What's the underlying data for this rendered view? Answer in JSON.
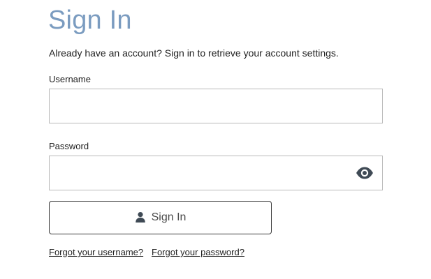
{
  "page": {
    "title": "Sign In",
    "intro": "Already have an account? Sign in to retrieve your account settings."
  },
  "form": {
    "username": {
      "label": "Username",
      "value": "",
      "placeholder": ""
    },
    "password": {
      "label": "Password",
      "value": "",
      "placeholder": "",
      "toggle_icon": "eye-icon"
    },
    "submit": {
      "label": "Sign In",
      "icon": "user-icon"
    }
  },
  "links": {
    "forgot_username": "Forgot your username?",
    "forgot_password": "Forgot your password?"
  },
  "colors": {
    "title": "#7b9cc0",
    "text": "#222222",
    "input_border": "#b9b9b9",
    "button_border": "#3a3a3a",
    "icon": "#3f4a55"
  }
}
